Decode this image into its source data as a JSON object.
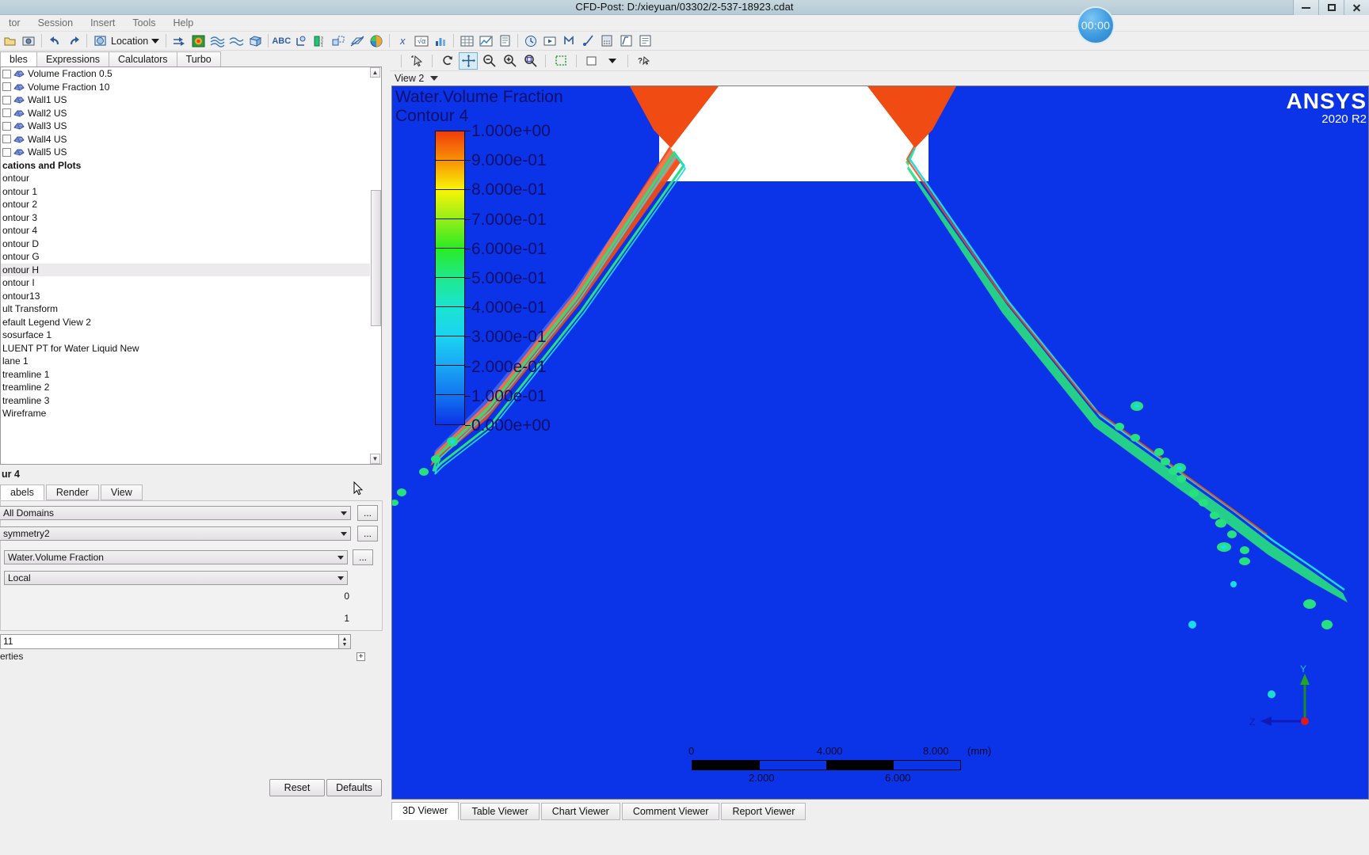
{
  "window": {
    "title": "CFD-Post: D:/xieyuan/03302/2-537-18923.cdat",
    "minimize_label": "minimize-icon",
    "maximize_label": "maximize-icon",
    "close_label": "close-icon"
  },
  "timer": {
    "value": "00:00"
  },
  "menu": {
    "items": [
      "tor",
      "Session",
      "Insert",
      "Tools",
      "Help"
    ]
  },
  "toolbar": {
    "location_label": "Location",
    "icons": [
      "open-icon",
      "snapshot-icon",
      "undo-icon",
      "redo-icon",
      "vector-icon",
      "contour-icon",
      "streamline-icon",
      "particle-track-icon",
      "volume-icon",
      "text-icon",
      "coordinate-frame-icon",
      "legend-icon",
      "instancing-icon",
      "clip-plane-icon",
      "color-map-icon",
      "variable-icon",
      "expression-icon",
      "table-icon",
      "chart-icon",
      "report-icon",
      "timestep-icon",
      "animation-icon",
      "macro-icon",
      "probe-icon",
      "calculator-icon",
      "function-icon",
      "session-icon"
    ]
  },
  "left_panel": {
    "tabs": [
      {
        "label": "bles",
        "active": false
      },
      {
        "label": "Expressions",
        "active": false
      },
      {
        "label": "Calculators",
        "active": false
      },
      {
        "label": "Turbo",
        "active": false
      }
    ],
    "tree_items": [
      {
        "label": "Volume Fraction 0.5",
        "checkbox": true,
        "icon": "mesh-icon",
        "selected": false,
        "bold": false
      },
      {
        "label": "Volume Fraction 10",
        "checkbox": true,
        "icon": "mesh-icon",
        "selected": false,
        "bold": false
      },
      {
        "label": "Wall1 US",
        "checkbox": true,
        "icon": "mesh-icon",
        "selected": false,
        "bold": false
      },
      {
        "label": "Wall2 US",
        "checkbox": true,
        "icon": "mesh-icon",
        "selected": false,
        "bold": false
      },
      {
        "label": "Wall3 US",
        "checkbox": true,
        "icon": "mesh-icon",
        "selected": false,
        "bold": false
      },
      {
        "label": "Wall4 US",
        "checkbox": true,
        "icon": "mesh-icon",
        "selected": false,
        "bold": false
      },
      {
        "label": "Wall5 US",
        "checkbox": true,
        "icon": "mesh-icon",
        "selected": false,
        "bold": false
      },
      {
        "label": "cations and Plots",
        "checkbox": false,
        "icon": "none",
        "selected": false,
        "bold": true
      },
      {
        "label": "ontour",
        "checkbox": false,
        "icon": "none",
        "selected": false,
        "bold": false
      },
      {
        "label": "ontour 1",
        "checkbox": false,
        "icon": "none",
        "selected": false,
        "bold": false
      },
      {
        "label": "ontour 2",
        "checkbox": false,
        "icon": "none",
        "selected": false,
        "bold": false
      },
      {
        "label": "ontour 3",
        "checkbox": false,
        "icon": "none",
        "selected": false,
        "bold": false
      },
      {
        "label": "ontour 4",
        "checkbox": false,
        "icon": "none",
        "selected": false,
        "bold": false
      },
      {
        "label": "ontour D",
        "checkbox": false,
        "icon": "none",
        "selected": false,
        "bold": false
      },
      {
        "label": "ontour G",
        "checkbox": false,
        "icon": "none",
        "selected": false,
        "bold": false
      },
      {
        "label": "ontour H",
        "checkbox": false,
        "icon": "none",
        "selected": true,
        "bold": false
      },
      {
        "label": "ontour I",
        "checkbox": false,
        "icon": "none",
        "selected": false,
        "bold": false
      },
      {
        "label": "ontour13",
        "checkbox": false,
        "icon": "none",
        "selected": false,
        "bold": false
      },
      {
        "label": "ult Transform",
        "checkbox": false,
        "icon": "none",
        "selected": false,
        "bold": false
      },
      {
        "label": "efault Legend View 2",
        "checkbox": false,
        "icon": "none",
        "selected": false,
        "bold": false
      },
      {
        "label": "sosurface 1",
        "checkbox": false,
        "icon": "none",
        "selected": false,
        "bold": false
      },
      {
        "label": "LUENT PT for Water Liquid New",
        "checkbox": false,
        "icon": "none",
        "selected": false,
        "bold": false
      },
      {
        "label": "lane 1",
        "checkbox": false,
        "icon": "none",
        "selected": false,
        "bold": false
      },
      {
        "label": "treamline 1",
        "checkbox": false,
        "icon": "none",
        "selected": false,
        "bold": false
      },
      {
        "label": "treamline 2",
        "checkbox": false,
        "icon": "none",
        "selected": false,
        "bold": false
      },
      {
        "label": "treamline 3",
        "checkbox": false,
        "icon": "none",
        "selected": false,
        "bold": false
      },
      {
        "label": "Wireframe",
        "checkbox": false,
        "icon": "none",
        "selected": false,
        "bold": false
      }
    ],
    "details": {
      "header": "ur 4",
      "tabs": [
        {
          "label": "abels",
          "active": false
        },
        {
          "label": "Render",
          "active": false
        },
        {
          "label": "View",
          "active": false
        }
      ],
      "domains_value": "All Domains",
      "locations_value": "symmetry2",
      "variable_value": "Water.Volume Fraction",
      "range_value": "Local",
      "min_value": "0",
      "max_value": "1",
      "contours_value": "11",
      "properties_label": "erties",
      "ellipsis_label": "...",
      "expand_label": "+"
    },
    "buttons": {
      "reset": "Reset",
      "defaults": "Defaults"
    }
  },
  "viewer": {
    "view_label": "View 2",
    "toolbar_icons": [
      "select-pick-icon",
      "rotate-icon",
      "pan-icon",
      "zoom-out-icon",
      "zoom-in-icon",
      "zoom-box-icon",
      "fit-view-icon",
      "view-preset-icon",
      "help-mode-icon"
    ],
    "tabs": [
      {
        "label": "3D Viewer",
        "active": true
      },
      {
        "label": "Table Viewer",
        "active": false
      },
      {
        "label": "Chart Viewer",
        "active": false
      },
      {
        "label": "Comment Viewer",
        "active": false
      },
      {
        "label": "Report Viewer",
        "active": false
      }
    ],
    "ansys_logo": {
      "line1": "ANSYS",
      "line2": "2020 R2"
    },
    "axis_triad": {
      "y_label": "Y",
      "z_label": "Z"
    },
    "scale_bar": {
      "unit": "(mm)",
      "labels_top": [
        "0",
        "4.000",
        "8.000"
      ],
      "labels_bottom": [
        "2.000",
        "6.000"
      ]
    },
    "legend": {
      "title_line1": "Water.Volume Fraction",
      "title_line2": "Contour 4",
      "labels": [
        "1.000e+00",
        "9.000e-01",
        "8.000e-01",
        "7.000e-01",
        "6.000e-01",
        "5.000e-01",
        "4.000e-01",
        "3.000e-01",
        "2.000e-01",
        "1.000e-01",
        "0.000e+00"
      ],
      "colors": [
        "#f03c0a",
        "#f79205",
        "#f9f405",
        "#96ee18",
        "#2aec22",
        "#1fe98a",
        "#1ae4d0",
        "#1ad4f2",
        "#1aa8f4",
        "#1276f0",
        "#0b33e8"
      ]
    },
    "colors": {
      "background": "#0b33e8",
      "geometry_fill": "#ffffff",
      "spray_high": "#ef4b13"
    }
  }
}
